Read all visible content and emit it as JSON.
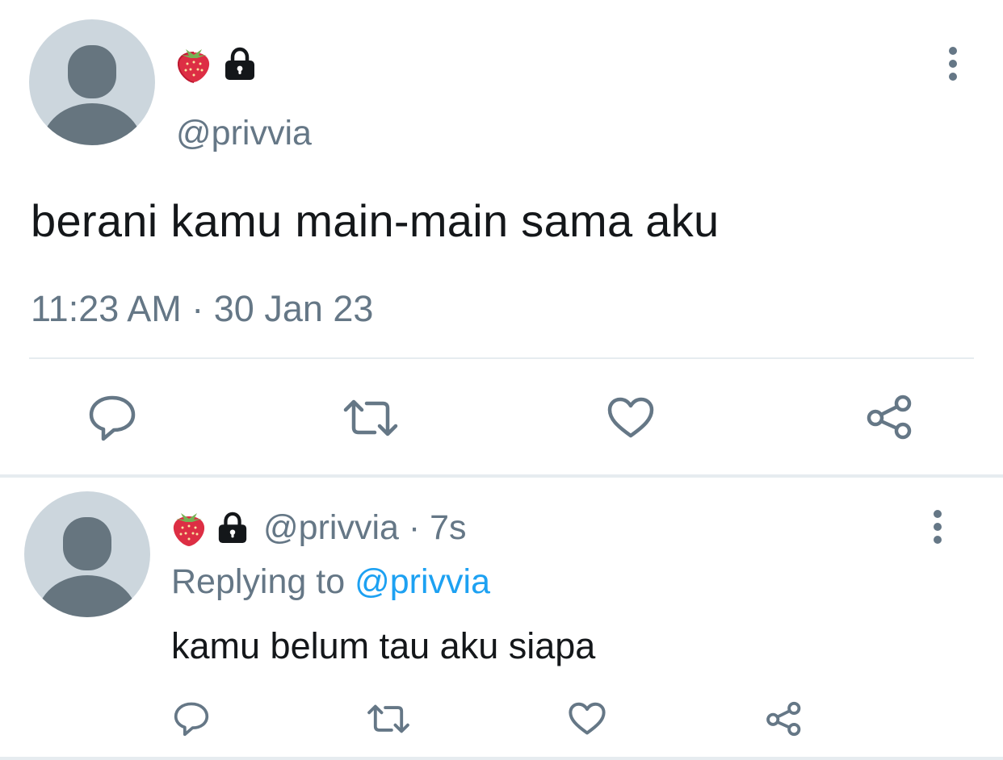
{
  "main_tweet": {
    "handle": "@privvia",
    "text": "berani kamu main-main sama aku",
    "timestamp": "11:23 AM · 30 Jan 23",
    "icons": [
      "strawberry-icon",
      "lock-icon"
    ]
  },
  "reply": {
    "handle": "@privvia",
    "time_separator": "·",
    "time": "7s",
    "replying_to_label": "Replying to",
    "replying_to_handle": "@privvia",
    "text": "kamu belum tau aku siapa"
  },
  "actions": [
    "reply-icon",
    "retweet-icon",
    "like-icon",
    "share-icon"
  ],
  "colors": {
    "text": "#14171a",
    "muted": "#657786",
    "accent": "#1da1f2",
    "divider": "#e6ecf0",
    "avatar_bg": "#ccd6dd"
  }
}
